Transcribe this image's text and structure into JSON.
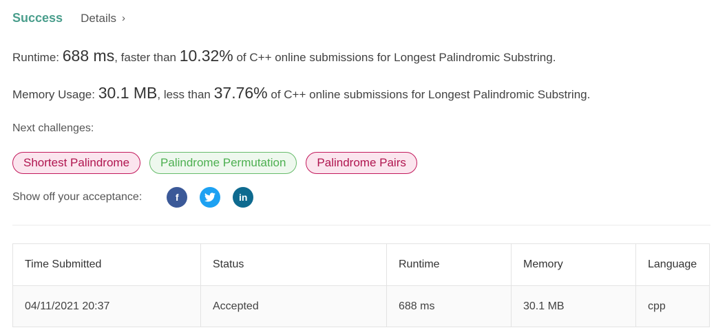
{
  "header": {
    "status": "Success",
    "details_label": "Details",
    "details_chevron": "›"
  },
  "runtime": {
    "label": "Runtime:",
    "value": "688 ms",
    "comparator": ", faster than",
    "percent": "10.32%",
    "suffix": "of C++ online submissions for Longest Palindromic Substring."
  },
  "memory": {
    "label": "Memory Usage:",
    "value": "30.1 MB",
    "comparator": ", less than",
    "percent": "37.76%",
    "suffix": "of C++ online submissions for Longest Palindromic Substring."
  },
  "next_challenges": {
    "label": "Next challenges:",
    "items": [
      {
        "label": "Shortest Palindrome",
        "color": "#c2185b"
      },
      {
        "label": "Palindrome Permutation",
        "color": "#66bb6a"
      },
      {
        "label": "Palindrome Pairs",
        "color": "#c2185b"
      }
    ]
  },
  "share": {
    "label": "Show off your acceptance:",
    "icons": [
      {
        "name": "facebook-icon",
        "glyph": "f"
      },
      {
        "name": "twitter-icon",
        "glyph": "t"
      },
      {
        "name": "linkedin-icon",
        "glyph": "in"
      }
    ]
  },
  "table": {
    "headers": [
      "Time Submitted",
      "Status",
      "Runtime",
      "Memory",
      "Language"
    ],
    "rows": [
      [
        "04/11/2021 20:37",
        "Accepted",
        "688 ms",
        "30.1 MB",
        "cpp"
      ]
    ]
  },
  "colors": {
    "accent": "#4a9e8c",
    "hard": "#c2185b",
    "easy": "#66bb6a"
  }
}
